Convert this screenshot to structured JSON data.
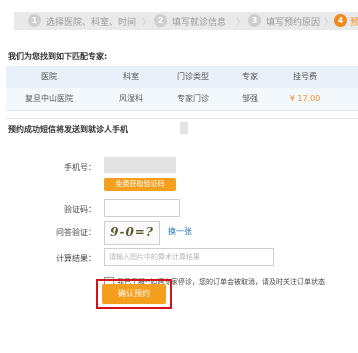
{
  "steps": [
    {
      "num": "1",
      "label": "选择医院、科室、时间"
    },
    {
      "num": "2",
      "label": "填写就诊信息"
    },
    {
      "num": "3",
      "label": "填写预约原因"
    },
    {
      "num": "4",
      "label": "预"
    }
  ],
  "step_separator": "〉",
  "match": {
    "title": "我们为您找到如下匹配专家:",
    "headers": [
      "医院",
      "科室",
      "门诊类型",
      "专家",
      "挂号费"
    ],
    "row": {
      "hospital": "复旦中山医院",
      "department": "风湿科",
      "clinic_type": "专家门诊",
      "doctor": "邹强",
      "fee": "¥ 17.00"
    }
  },
  "notice": {
    "title": "预约成功短信将发送到就诊人手机"
  },
  "form": {
    "phone_label": "手机号：",
    "get_code_button": "免费获取验证码",
    "code_label": "验证码：",
    "captcha_label": "问答验证：",
    "captcha_text": "9-0=?",
    "refresh_link": "换一张",
    "result_label": "计算结果：",
    "result_placeholder": "请输入图片中的算术计算结果",
    "agree_text": "我已了解--如遇专家停诊，您的订单会被取消，请及时关注订单状态",
    "confirm_button": "确认预约"
  },
  "colors": {
    "accent": "#f59f1f",
    "highlight": "#d0141a",
    "link": "#1a73c9"
  }
}
